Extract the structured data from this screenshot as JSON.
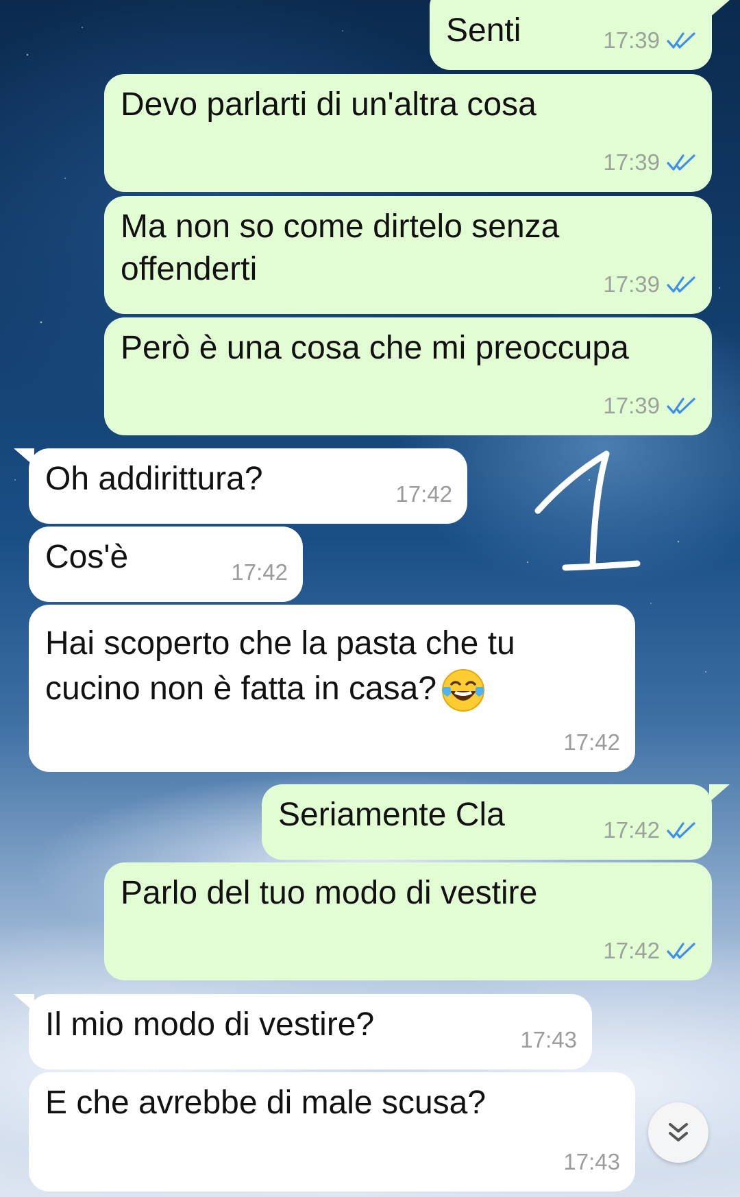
{
  "messages": [
    {
      "dir": "out",
      "text": "Senti",
      "time": "17:39",
      "status": "read"
    },
    {
      "dir": "out",
      "text": "Devo parlarti di un'altra cosa",
      "time": "17:39",
      "status": "read"
    },
    {
      "dir": "out",
      "text": "Ma non so come dirtelo senza offenderti",
      "time": "17:39",
      "status": "read"
    },
    {
      "dir": "out",
      "text": "Però è una cosa che mi preoccupa",
      "time": "17:39",
      "status": "read"
    },
    {
      "dir": "in",
      "text": "Oh addirittura?",
      "time": "17:42"
    },
    {
      "dir": "in",
      "text": "Cos'è",
      "time": "17:42"
    },
    {
      "dir": "in",
      "text": "Hai scoperto che la pasta che tu cucino non è fatta in casa?",
      "emoji": "face-with-tears-of-joy",
      "time": "17:42"
    },
    {
      "dir": "out",
      "text": "Seriamente Cla",
      "time": "17:42",
      "status": "read"
    },
    {
      "dir": "out",
      "text": "Parlo del tuo modo di vestire",
      "time": "17:42",
      "status": "read"
    },
    {
      "dir": "in",
      "text": "Il mio modo di vestire?",
      "time": "17:43"
    },
    {
      "dir": "in",
      "text": "E che avrebbe di male scusa?",
      "time": "17:43"
    }
  ],
  "annotation": {
    "text": "1"
  },
  "colors": {
    "outgoing_bubble": "#e2fcd4",
    "incoming_bubble": "#ffffff",
    "read_ticks": "#3d8fe8",
    "timestamp": "#9aa39a"
  },
  "icons": {
    "read_receipt": "double-check-icon",
    "scroll_down": "double-chevron-down-icon"
  }
}
